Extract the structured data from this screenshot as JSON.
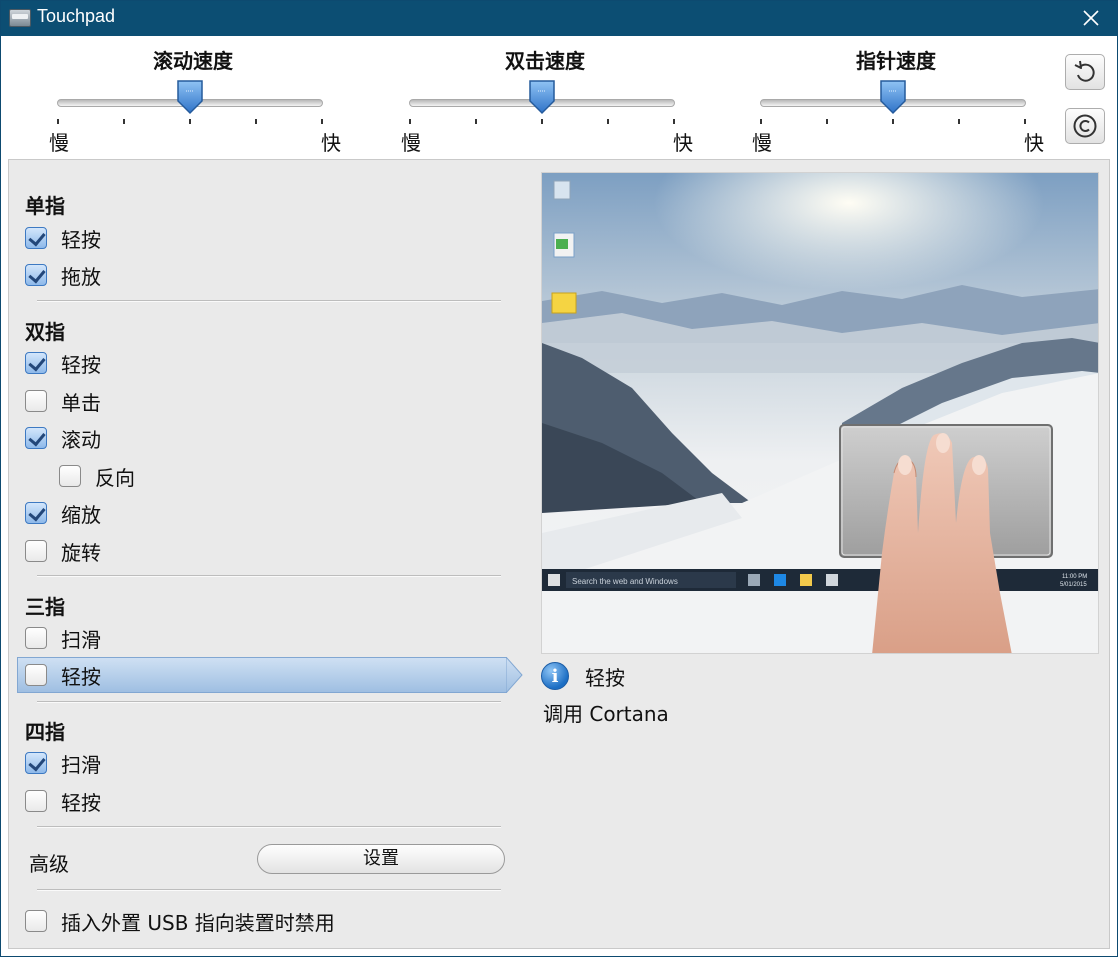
{
  "window": {
    "title": "Touchpad"
  },
  "sliders": [
    {
      "title": "滚动速度",
      "slow": "慢",
      "fast": "快",
      "value_fraction": 0.5
    },
    {
      "title": "双击速度",
      "slow": "慢",
      "fast": "快",
      "value_fraction": 0.5
    },
    {
      "title": "指针速度",
      "slow": "慢",
      "fast": "快",
      "value_fraction": 0.5
    }
  ],
  "side_buttons": {
    "reset_icon": "reset-icon",
    "copyright_icon": "copyright-icon"
  },
  "sections": {
    "one_finger": {
      "title": "单指",
      "items": [
        {
          "label": "轻按",
          "checked": true
        },
        {
          "label": "拖放",
          "checked": true
        }
      ]
    },
    "two_finger": {
      "title": "双指",
      "items": [
        {
          "label": "轻按",
          "checked": true
        },
        {
          "label": "单击",
          "checked": false
        },
        {
          "label": "滚动",
          "checked": true
        },
        {
          "label": "反向",
          "checked": false
        },
        {
          "label": "缩放",
          "checked": true
        },
        {
          "label": "旋转",
          "checked": false
        }
      ]
    },
    "three_finger": {
      "title": "三指",
      "items": [
        {
          "label": "扫滑",
          "checked": false
        },
        {
          "label": "轻按",
          "checked": false,
          "selected": true
        }
      ]
    },
    "four_finger": {
      "title": "四指",
      "items": [
        {
          "label": "扫滑",
          "checked": true
        },
        {
          "label": "轻按",
          "checked": false
        }
      ]
    }
  },
  "advanced": {
    "label": "高级",
    "button": "设置"
  },
  "usb_disable": {
    "label": "插入外置 USB 指向装置时禁用",
    "checked": false
  },
  "preview": {
    "info_title": "轻按",
    "info_desc": "调用 Cortana",
    "taskbar_search": "Search the web and Windows",
    "tray_time": "11:00 PM",
    "tray_date": "5/01/2015"
  },
  "colors": {
    "titlebar": "#0c4e73",
    "selection": "#9fbfe2",
    "check": "#3d79c2"
  }
}
